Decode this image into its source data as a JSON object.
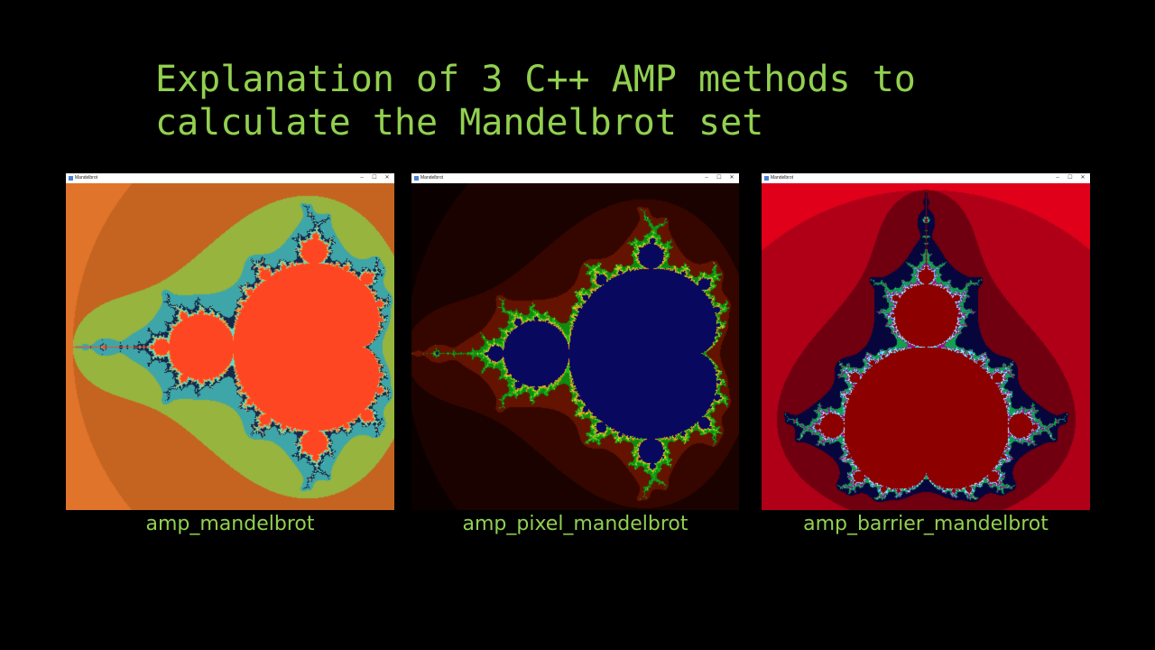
{
  "slide": {
    "title_lines": [
      "Explanation of 3 C++ AMP methods to",
      "calculate the Mandelbrot set"
    ]
  },
  "windows": [
    {
      "title": "Mandelbrot",
      "caption": "amp_mandelbrot",
      "palette": [
        "#f01e8c",
        "#e0742a",
        "#c46420",
        "#96b43e",
        "#3ea6a8",
        "#16284a",
        "#5ae0c8",
        "#e8b040",
        "#ff4622"
      ],
      "inside_color": "#ff4622"
    },
    {
      "title": "Mandelbrot",
      "caption": "amp_pixel_mandelbrot",
      "palette": [
        "#000000",
        "#0a0000",
        "#1a0200",
        "#350600",
        "#641300",
        "#0e8a10",
        "#18c018",
        "#e0d020",
        "#ff7a10"
      ],
      "inside_color": "#08085e"
    },
    {
      "title": "Mandelbrot",
      "caption": "amp_barrier_mandelbrot",
      "palette": [
        "#200000",
        "#e0001a",
        "#b00018",
        "#700010",
        "#06063c",
        "#10a050",
        "#9a1080",
        "#30e0ff",
        "#e8e8ff"
      ],
      "inside_color": "#8c0000"
    }
  ],
  "icons": {
    "minimize": "minimize-icon",
    "maximize": "maximize-icon",
    "close": "close-icon"
  }
}
